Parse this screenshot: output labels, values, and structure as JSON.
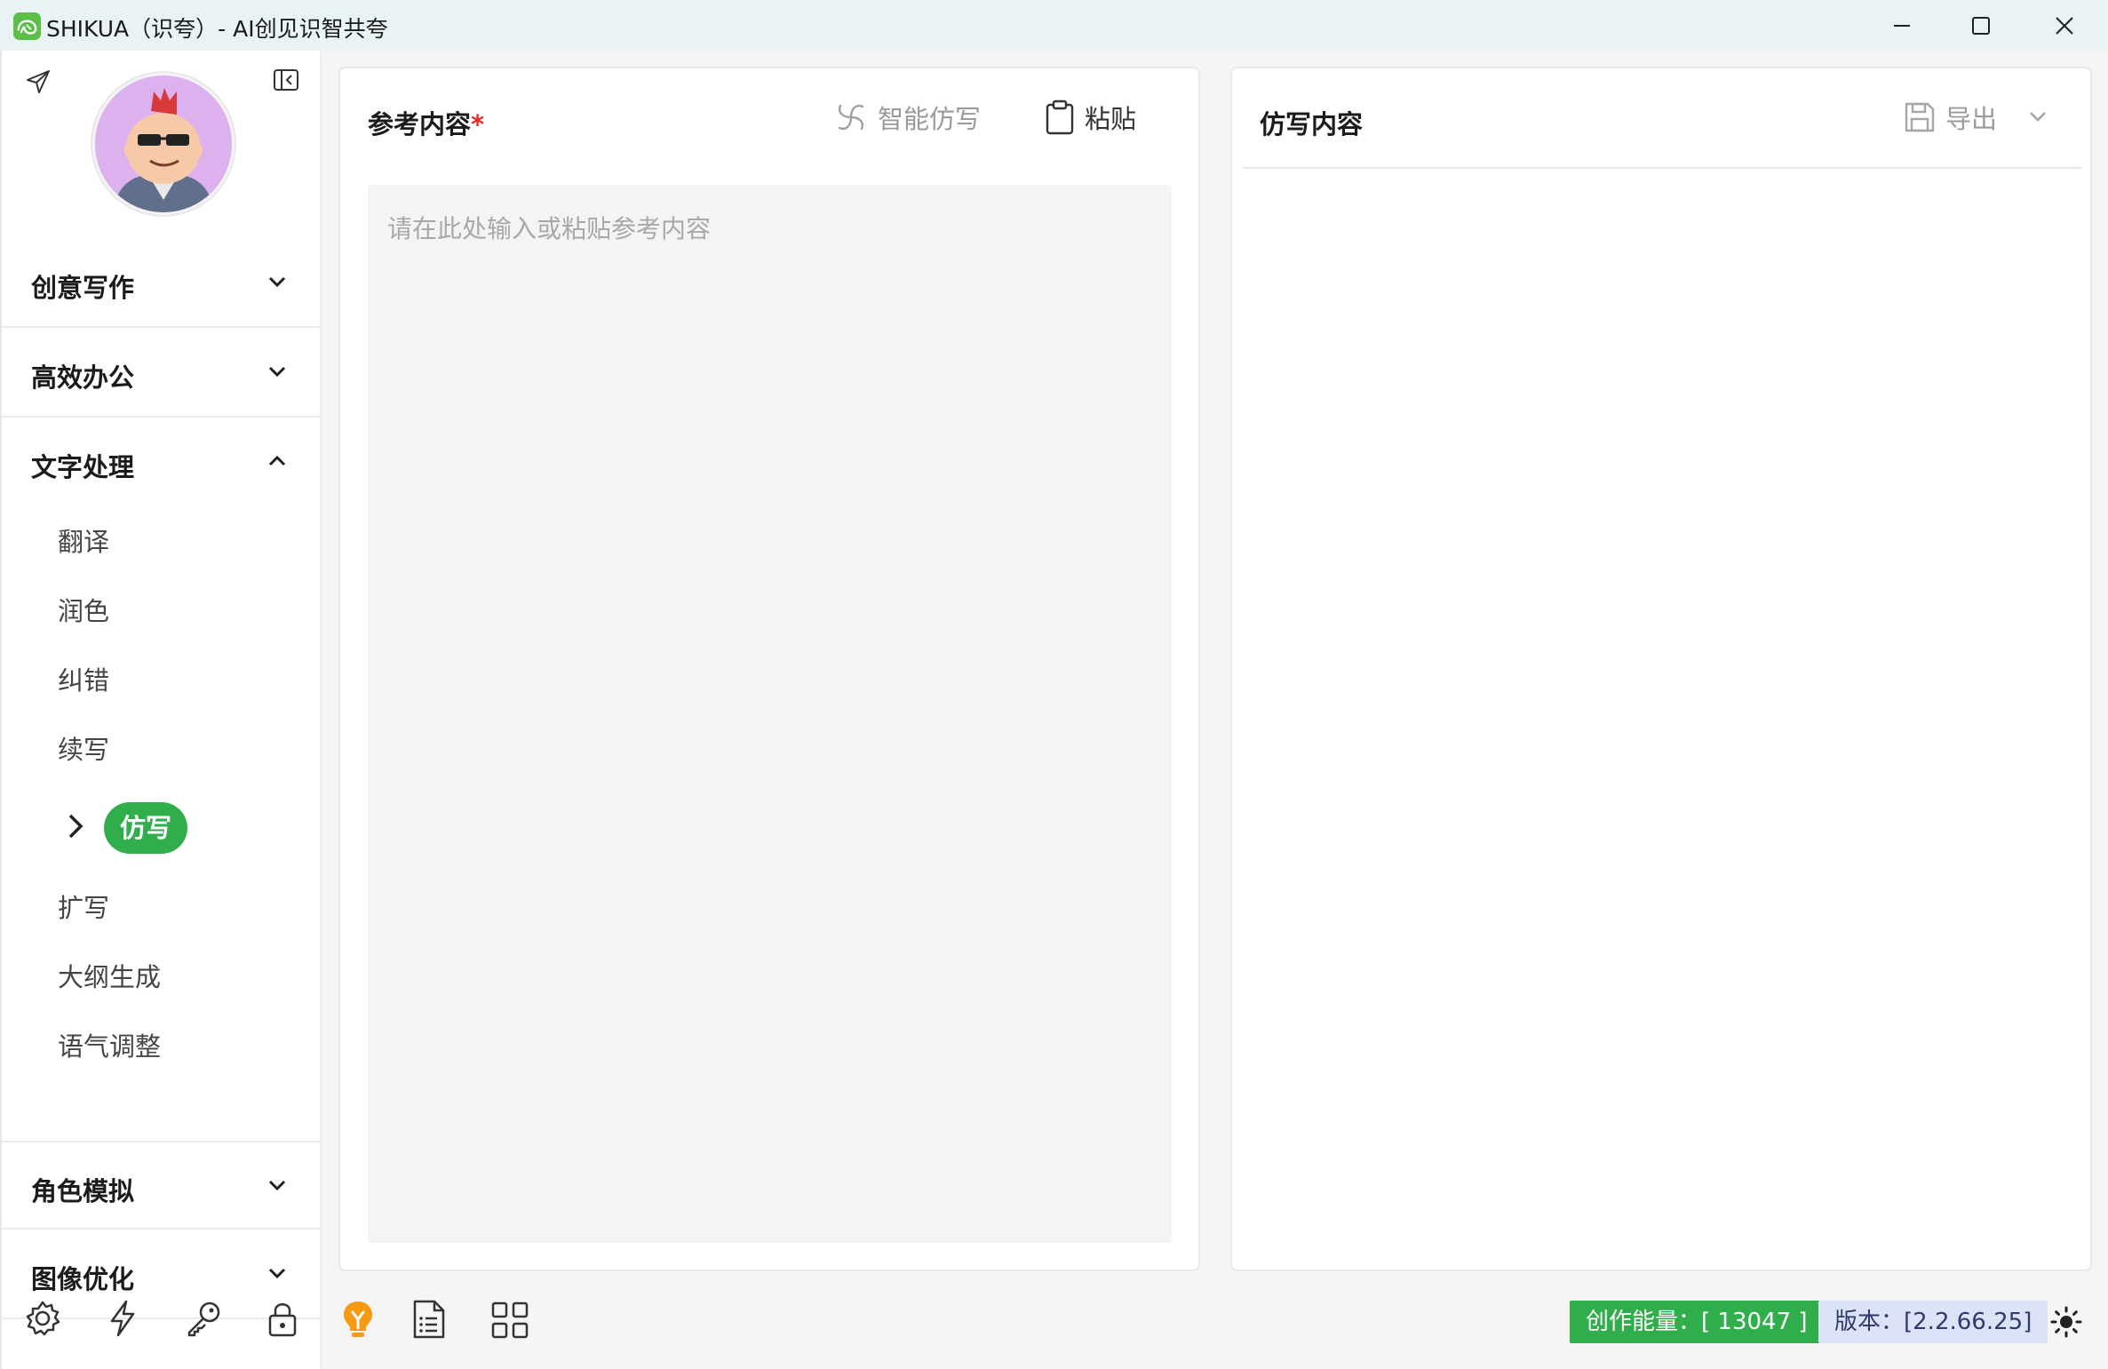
{
  "window": {
    "title": "SHIKUA（识夸）- AI创见识智共夸",
    "controls": [
      "minimize-icon",
      "maximize-icon",
      "close-icon"
    ]
  },
  "sidebar": {
    "groups": [
      {
        "label": "创意写作",
        "expanded": false
      },
      {
        "label": "高效办公",
        "expanded": false
      },
      {
        "label": "文字处理",
        "expanded": true
      },
      {
        "label": "角色模拟",
        "expanded": false
      },
      {
        "label": "图像优化",
        "expanded": false
      }
    ],
    "text_items": [
      {
        "label": "翻译"
      },
      {
        "label": "润色"
      },
      {
        "label": "纠错"
      },
      {
        "label": "续写"
      },
      {
        "label": "仿写",
        "active": true
      },
      {
        "label": "扩写"
      },
      {
        "label": "大纲生成"
      },
      {
        "label": "语气调整"
      }
    ],
    "bottom_icons": [
      "settings-icon",
      "lightning-icon",
      "key-icon",
      "lock-icon"
    ]
  },
  "left_panel": {
    "title": "参考内容",
    "required_mark": "*",
    "smart_button": "智能仿写",
    "paste_button": "粘贴",
    "input_placeholder": "请在此处输入或粘贴参考内容",
    "input_value": ""
  },
  "right_panel": {
    "title": "仿写内容",
    "export_button": "导出"
  },
  "status": {
    "icons": [
      "lightbulb-icon",
      "document-list-icon",
      "grid-icon"
    ],
    "energy": "创作能量：[ 13047 ]",
    "version": "版本：[2.2.66.25]",
    "theme_icon": "sun-icon"
  },
  "colors": {
    "accent": "#2fae4b",
    "titlebar_bg": "#e9f3f4",
    "version_bg": "#dde3f7",
    "required": "#e32b2b"
  }
}
